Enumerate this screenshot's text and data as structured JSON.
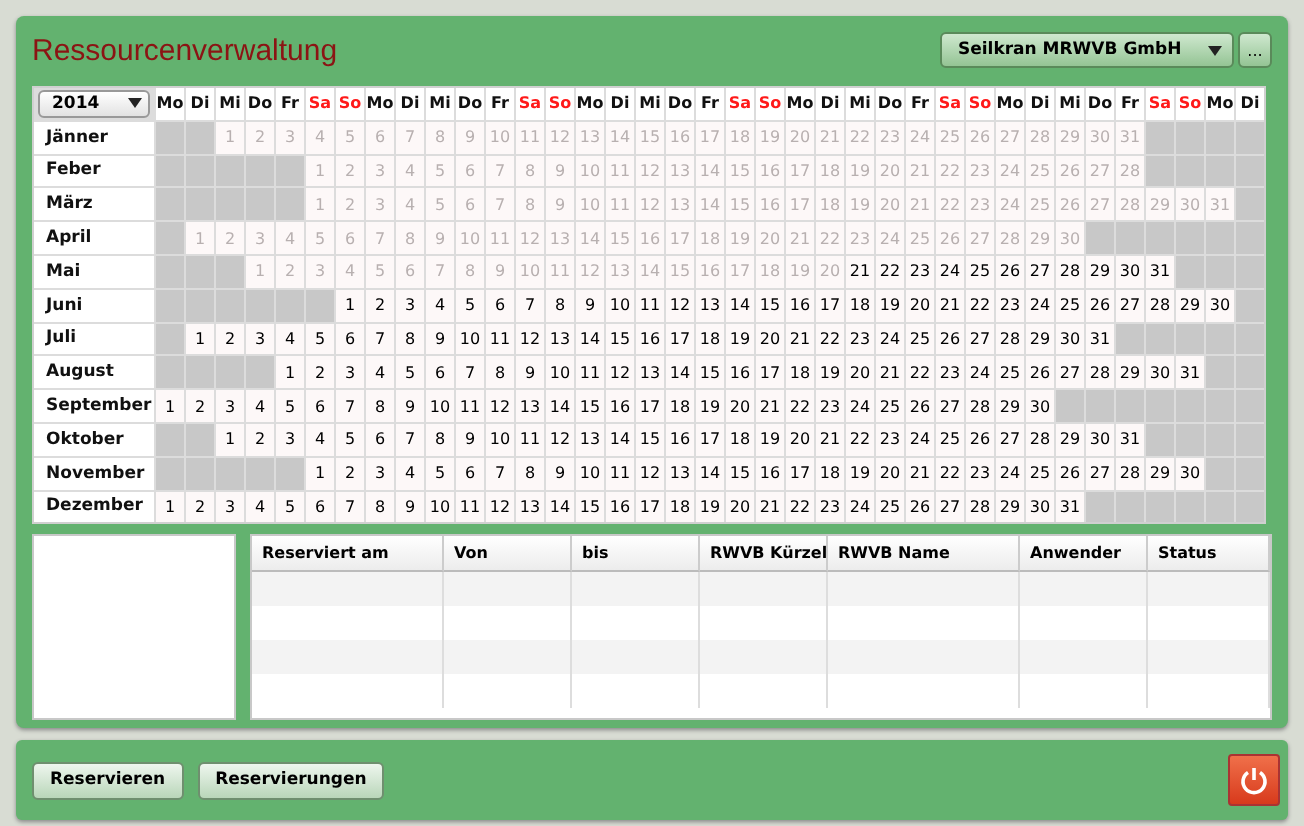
{
  "window": {
    "title": "Ressourcenverwaltung"
  },
  "resource_select": {
    "value": "Seilkran MRWVB GmbH",
    "more_button": "..."
  },
  "calendar": {
    "year": "2014",
    "weekdays": [
      {
        "label": "Mo",
        "weekend": false
      },
      {
        "label": "Di",
        "weekend": false
      },
      {
        "label": "Mi",
        "weekend": false
      },
      {
        "label": "Do",
        "weekend": false
      },
      {
        "label": "Fr",
        "weekend": false
      },
      {
        "label": "Sa",
        "weekend": true
      },
      {
        "label": "So",
        "weekend": true
      },
      {
        "label": "Mo",
        "weekend": false
      },
      {
        "label": "Di",
        "weekend": false
      },
      {
        "label": "Mi",
        "weekend": false
      },
      {
        "label": "Do",
        "weekend": false
      },
      {
        "label": "Fr",
        "weekend": false
      },
      {
        "label": "Sa",
        "weekend": true
      },
      {
        "label": "So",
        "weekend": true
      },
      {
        "label": "Mo",
        "weekend": false
      },
      {
        "label": "Di",
        "weekend": false
      },
      {
        "label": "Mi",
        "weekend": false
      },
      {
        "label": "Do",
        "weekend": false
      },
      {
        "label": "Fr",
        "weekend": false
      },
      {
        "label": "Sa",
        "weekend": true
      },
      {
        "label": "So",
        "weekend": true
      },
      {
        "label": "Mo",
        "weekend": false
      },
      {
        "label": "Di",
        "weekend": false
      },
      {
        "label": "Mi",
        "weekend": false
      },
      {
        "label": "Do",
        "weekend": false
      },
      {
        "label": "Fr",
        "weekend": false
      },
      {
        "label": "Sa",
        "weekend": true
      },
      {
        "label": "So",
        "weekend": true
      },
      {
        "label": "Mo",
        "weekend": false
      },
      {
        "label": "Di",
        "weekend": false
      },
      {
        "label": "Mi",
        "weekend": false
      },
      {
        "label": "Do",
        "weekend": false
      },
      {
        "label": "Fr",
        "weekend": false
      },
      {
        "label": "Sa",
        "weekend": true
      },
      {
        "label": "So",
        "weekend": true
      },
      {
        "label": "Mo",
        "weekend": false
      },
      {
        "label": "Di",
        "weekend": false
      }
    ],
    "months": [
      {
        "name": "Jänner",
        "leading": [
          {
            "kind": "blank"
          },
          {
            "kind": "blank"
          }
        ],
        "past_days": [
          "1",
          "2",
          "3",
          "4",
          "5",
          "6",
          "7",
          "8",
          "9",
          "10",
          "11",
          "12",
          "13",
          "14",
          "15",
          "16",
          "17",
          "18",
          "19",
          "20",
          "21",
          "22",
          "23",
          "24",
          "25",
          "26",
          "27",
          "28",
          "29",
          "30",
          "31"
        ]
      },
      {
        "name": "Feber",
        "leading": [
          {
            "kind": "blank"
          },
          {
            "kind": "blank"
          },
          {
            "kind": "blank"
          },
          {
            "kind": "blank"
          },
          {
            "kind": "blank"
          }
        ],
        "past_days": [
          "1",
          "2",
          "3",
          "4",
          "5",
          "6",
          "7",
          "8",
          "9",
          "10",
          "11",
          "12",
          "13",
          "14",
          "15",
          "16",
          "17",
          "18",
          "19",
          "20",
          "21",
          "22",
          "23",
          "24",
          "25",
          "26",
          "27",
          "28"
        ]
      },
      {
        "name": "März",
        "leading": [
          {
            "kind": "blank"
          },
          {
            "kind": "blank"
          },
          {
            "kind": "blank"
          },
          {
            "kind": "blank"
          },
          {
            "kind": "blank"
          }
        ],
        "past_days": [
          "1",
          "2",
          "3",
          "4",
          "5",
          "6",
          "7",
          "8",
          "9",
          "10",
          "11",
          "12",
          "13",
          "14",
          "15",
          "16",
          "17",
          "18",
          "19",
          "20",
          "21",
          "22",
          "23",
          "24",
          "25",
          "26",
          "27",
          "28",
          "29",
          "30",
          "31"
        ]
      },
      {
        "name": "April",
        "leading": [
          {
            "kind": "blank"
          }
        ],
        "past_days": [
          "1",
          "2",
          "3",
          "4",
          "5",
          "6",
          "7",
          "8",
          "9",
          "10",
          "11",
          "12",
          "13",
          "14",
          "15",
          "16",
          "17",
          "18",
          "19",
          "20",
          "21",
          "22",
          "23",
          "24",
          "25",
          "26",
          "27",
          "28",
          "29",
          "30"
        ]
      },
      {
        "name": "Mai",
        "leading": [
          {
            "kind": "blank"
          },
          {
            "kind": "blank"
          },
          {
            "kind": "blank"
          }
        ],
        "past_days": [
          "1",
          "2",
          "3",
          "4",
          "5",
          "6",
          "7",
          "8",
          "9",
          "10",
          "11",
          "12",
          "13",
          "14",
          "15",
          "16",
          "17",
          "18",
          "19",
          "20"
        ],
        "days": [
          "21",
          "22",
          "23",
          "24",
          "25",
          "26",
          "27",
          "28",
          "29",
          "30",
          "31"
        ]
      },
      {
        "name": "Juni",
        "leading": [
          {
            "kind": "blank"
          },
          {
            "kind": "blank"
          },
          {
            "kind": "blank"
          },
          {
            "kind": "blank"
          },
          {
            "kind": "blank"
          },
          {
            "kind": "blank"
          }
        ],
        "days": [
          "1",
          "2",
          "3",
          "4",
          "5",
          "6",
          "7",
          "8",
          "9",
          "10",
          "11",
          "12",
          "13",
          "14",
          "15",
          "16",
          "17",
          "18",
          "19",
          "20",
          "21",
          "22",
          "23",
          "24",
          "25",
          "26",
          "27",
          "28",
          "29",
          "30"
        ]
      },
      {
        "name": "Juli",
        "leading": [
          {
            "kind": "blank"
          }
        ],
        "days": [
          "1",
          "2",
          "3",
          "4",
          "5",
          "6",
          "7",
          "8",
          "9",
          "10",
          "11",
          "12",
          "13",
          "14",
          "15",
          "16",
          "17",
          "18",
          "19",
          "20",
          "21",
          "22",
          "23",
          "24",
          "25",
          "26",
          "27",
          "28",
          "29",
          "30",
          "31"
        ]
      },
      {
        "name": "August",
        "leading": [
          {
            "kind": "blank"
          },
          {
            "kind": "blank"
          },
          {
            "kind": "blank"
          },
          {
            "kind": "blank"
          }
        ],
        "days": [
          "1",
          "2",
          "3",
          "4",
          "5",
          "6",
          "7",
          "8",
          "9",
          "10",
          "11",
          "12",
          "13",
          "14",
          "15",
          "16",
          "17",
          "18",
          "19",
          "20",
          "21",
          "22",
          "23",
          "24",
          "25",
          "26",
          "27",
          "28",
          "29",
          "30",
          "31"
        ]
      },
      {
        "name": "September",
        "days": [
          "1",
          "2",
          "3",
          "4",
          "5",
          "6",
          "7",
          "8",
          "9",
          "10",
          "11",
          "12",
          "13",
          "14",
          "15",
          "16",
          "17",
          "18",
          "19",
          "20",
          "21",
          "22",
          "23",
          "24",
          "25",
          "26",
          "27",
          "28",
          "29",
          "30"
        ]
      },
      {
        "name": "Oktober",
        "leading": [
          {
            "kind": "blank"
          },
          {
            "kind": "blank"
          }
        ],
        "days": [
          "1",
          "2",
          "3",
          "4",
          "5",
          "6",
          "7",
          "8",
          "9",
          "10",
          "11",
          "12",
          "13",
          "14",
          "15",
          "16",
          "17",
          "18",
          "19",
          "20",
          "21",
          "22",
          "23",
          "24",
          "25",
          "26",
          "27",
          "28",
          "29",
          "30",
          "31"
        ]
      },
      {
        "name": "November",
        "leading": [
          {
            "kind": "blank"
          },
          {
            "kind": "blank"
          },
          {
            "kind": "blank"
          },
          {
            "kind": "blank"
          },
          {
            "kind": "blank"
          }
        ],
        "days": [
          "1",
          "2",
          "3",
          "4",
          "5",
          "6",
          "7",
          "8",
          "9",
          "10",
          "11",
          "12",
          "13",
          "14",
          "15",
          "16",
          "17",
          "18",
          "19",
          "20",
          "21",
          "22",
          "23",
          "24",
          "25",
          "26",
          "27",
          "28",
          "29",
          "30"
        ]
      },
      {
        "name": "Dezember",
        "days": [
          "1",
          "2",
          "3",
          "4",
          "5",
          "6",
          "7",
          "8",
          "9",
          "10",
          "11",
          "12",
          "13",
          "14",
          "15",
          "16",
          "17",
          "18",
          "19",
          "20",
          "21",
          "22",
          "23",
          "24",
          "25",
          "26",
          "27",
          "28",
          "29",
          "30",
          "31"
        ]
      }
    ]
  },
  "table": {
    "columns": [
      "Reserviert am",
      "Von",
      "bis",
      "RWVB Kürzel",
      "RWVB Name",
      "Anwender",
      "Status"
    ]
  },
  "buttons": [
    "Reservieren",
    "Reservierungen"
  ]
}
